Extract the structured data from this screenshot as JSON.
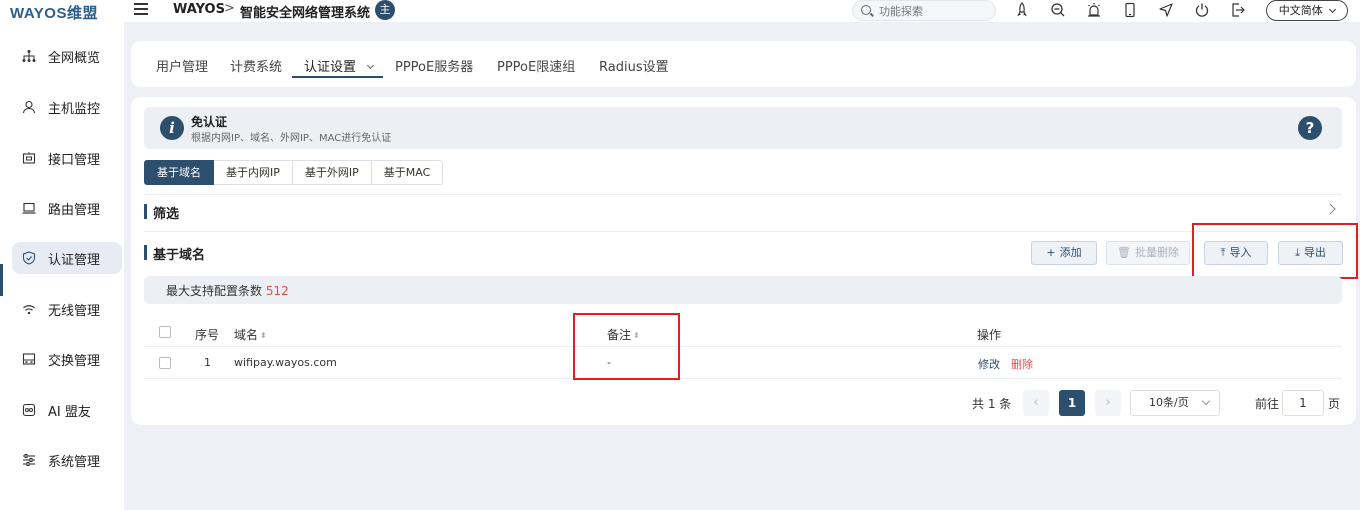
{
  "header": {
    "logo": "WAYOS维盟",
    "brand": "WAYOS",
    "separator": ">",
    "system_title": "智能安全网络管理系统",
    "badge": "主",
    "search_placeholder": "功能探索",
    "language": "中文简体"
  },
  "sidebar": {
    "items": [
      {
        "label": "全网概览",
        "icon": "network-tree-icon"
      },
      {
        "label": "主机监控",
        "icon": "user-icon"
      },
      {
        "label": "接口管理",
        "icon": "interface-icon"
      },
      {
        "label": "路由管理",
        "icon": "laptop-icon"
      },
      {
        "label": "认证管理",
        "icon": "shield-icon",
        "active": true
      },
      {
        "label": "无线管理",
        "icon": "wifi-icon"
      },
      {
        "label": "交换管理",
        "icon": "switch-icon"
      },
      {
        "label": "AI 盟友",
        "icon": "ai-icon"
      },
      {
        "label": "系统管理",
        "icon": "sliders-icon"
      }
    ]
  },
  "tabs": [
    {
      "label": "用户管理"
    },
    {
      "label": "计费系统"
    },
    {
      "label": "认证设置",
      "active": true
    },
    {
      "label": "PPPoE服务器"
    },
    {
      "label": "PPPoE限速组"
    },
    {
      "label": "Radius设置"
    }
  ],
  "info": {
    "title": "免认证",
    "subtitle": "根据内网IP、域名、外网IP、MAC进行免认证",
    "help": "?"
  },
  "sub_tabs": [
    {
      "label": "基于域名",
      "active": true
    },
    {
      "label": "基于内网IP"
    },
    {
      "label": "基于外网IP"
    },
    {
      "label": "基于MAC"
    }
  ],
  "filter": {
    "title": "筛选"
  },
  "list_section": {
    "title": "基于域名"
  },
  "buttons": {
    "add": "添加",
    "batch_delete": "批量删除",
    "import": "导入",
    "export": "导出"
  },
  "max_config": {
    "label": "最大支持配置条数",
    "value": "512"
  },
  "table": {
    "headers": {
      "index": "序号",
      "domain": "域名",
      "remark": "备注",
      "action": "操作"
    },
    "rows": [
      {
        "index": "1",
        "domain": "wifipay.wayos.com",
        "remark": "-",
        "edit": "修改",
        "delete": "删除"
      }
    ]
  },
  "pagination": {
    "total": "共 1 条",
    "current_page": "1",
    "page_size": "10条/页",
    "goto_label": "前往",
    "goto_value": "1",
    "page_suffix": "页"
  },
  "colors": {
    "primary": "#2c4f6e",
    "danger": "#e05050",
    "highlight": "#e02020"
  }
}
